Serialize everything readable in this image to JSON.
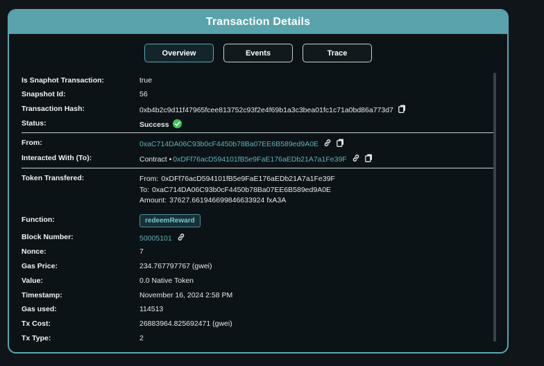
{
  "modal": {
    "title": "Transaction Details",
    "tabs": [
      "Overview",
      "Events",
      "Trace"
    ]
  },
  "fields": {
    "is_snapshot": {
      "label": "Is Snaphot Transaction:",
      "value": "true"
    },
    "snapshot_id": {
      "label": "Snapshot Id:",
      "value": "56"
    },
    "tx_hash": {
      "label": "Transaction Hash:",
      "value": "0xb4b2c9d11f47965fcee813752c93f2e4f69b1a3c3bea01fc1c71a0bd86a773d7"
    },
    "status": {
      "label": "Status:",
      "value": "Success"
    },
    "from": {
      "label": "From:",
      "value": "0xaC714DA06C93b0cF4450b78Ba07EE6B589ed9A0E"
    },
    "interacted": {
      "label": "Interacted With (To):",
      "prefix": "Contract •",
      "value": "0xDFf76acD594101fB5e9FaE176aEDb21A7a1Fe39F"
    },
    "token": {
      "label": "Token Transfered:",
      "from_label": "From:",
      "from": "0xDFf76acD594101fB5e9FaE176aEDb21A7a1Fe39F",
      "to_label": "To:",
      "to": "0xaC714DA06C93b0cF4450b78Ba07EE6B589ed9A0E",
      "amount_label": "Amount:",
      "amount": "37627.661946699846633924 fxA3A"
    },
    "function": {
      "label": "Function:",
      "value": "redeemReward"
    },
    "block": {
      "label": "Block Number:",
      "value": "50005101"
    },
    "nonce": {
      "label": "Nonce:",
      "value": "7"
    },
    "gas_price": {
      "label": "Gas Price:",
      "value": "234.767797767 (gwei)"
    },
    "value": {
      "label": "Value:",
      "value": "0.0 Native Token"
    },
    "timestamp": {
      "label": "Timestamp:",
      "value": "November 16, 2024 2:58 PM"
    },
    "gas_used": {
      "label": "Gas used:",
      "value": "114513"
    },
    "tx_cost": {
      "label": "Tx Cost:",
      "value": "26883964.825692471 (gwei)"
    },
    "tx_type": {
      "label": "Tx Type:",
      "value": "2"
    }
  },
  "icons": {
    "copy": "copy-icon",
    "link": "link-icon",
    "success": "check-circle-icon"
  },
  "colors": {
    "accent": "#5aa3ad",
    "link": "#5fb3bf",
    "success": "#3cc45a",
    "background": "#0c1316"
  }
}
